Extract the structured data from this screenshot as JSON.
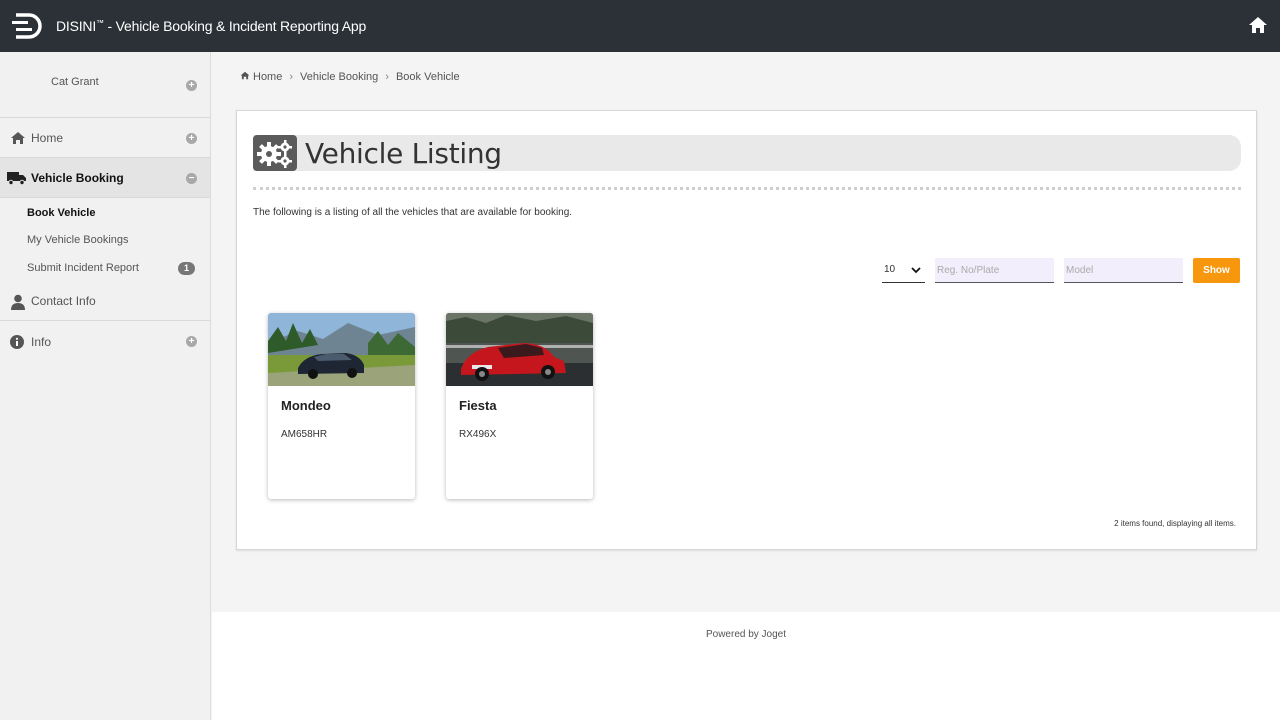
{
  "header": {
    "app_name": "DISINI",
    "trademark": "™",
    "title_rest": " - Vehicle Booking & Incident Reporting App",
    "logo_icon": "disini-logo-icon",
    "home_icon": "home-icon"
  },
  "sidebar": {
    "user_name": "Cat Grant",
    "items": [
      {
        "label": "Home",
        "icon": "home-icon"
      },
      {
        "label": "Vehicle Booking",
        "icon": "truck-icon",
        "active": true
      },
      {
        "label": "Contact Info",
        "icon": "user-icon"
      },
      {
        "label": "Info",
        "icon": "info-icon"
      }
    ],
    "sub_items": [
      {
        "label": "Book Vehicle"
      },
      {
        "label": "My Vehicle Bookings"
      },
      {
        "label": "Submit Incident Report",
        "badge": "1"
      }
    ]
  },
  "breadcrumb": {
    "items": [
      "Home",
      "Vehicle Booking",
      "Book Vehicle"
    ],
    "separator": "›"
  },
  "page": {
    "title": "Vehicle Listing",
    "description": "The following is a listing of all the vehicles that are available for booking.",
    "page_size": "10",
    "reg_placeholder": "Reg. No/Plate",
    "model_placeholder": "Model",
    "show_label": "Show",
    "accent": "#f7970e",
    "count_text": "2 items found, displaying all items."
  },
  "vehicles": [
    {
      "model": "Mondeo",
      "reg": "AM658HR",
      "color": "#1e2633"
    },
    {
      "model": "Fiesta",
      "reg": "RX496X",
      "color": "#c4161c"
    }
  ],
  "footer": {
    "powered_by": "Powered by Joget"
  }
}
